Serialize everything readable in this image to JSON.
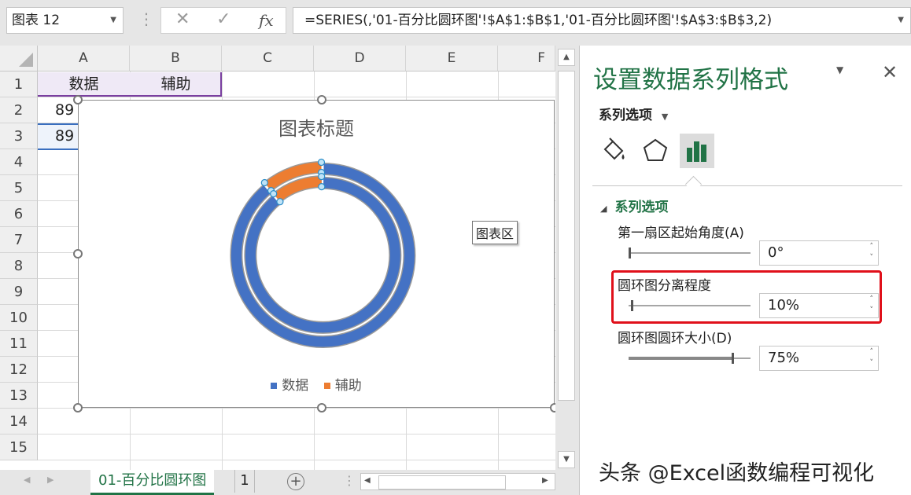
{
  "formula_bar": {
    "name_box": "图表 12",
    "formula": "=SERIES(,'01-百分比圆环图'!$A$1:$B$1,'01-百分比圆环图'!$A$3:$B$3,2)",
    "cancel_glyph": "✕",
    "enter_glyph": "✓",
    "fx_glyph": "fx"
  },
  "columns": [
    "A",
    "B",
    "C",
    "D",
    "E",
    "F"
  ],
  "rows": [
    "1",
    "2",
    "3",
    "4",
    "5",
    "6",
    "7",
    "8",
    "9",
    "10",
    "11",
    "12",
    "13",
    "14",
    "15"
  ],
  "cells": {
    "a1": "数据",
    "b1": "辅助",
    "a2": "89",
    "a3": "89"
  },
  "chart": {
    "title": "图表标题",
    "tooltip": "图表区",
    "legend": [
      {
        "name": "数据",
        "color": "#4472c4"
      },
      {
        "name": "辅助",
        "color": "#ed7d31"
      }
    ]
  },
  "chart_data": {
    "type": "doughnut",
    "title": "图表标题",
    "categories": [
      "数据",
      "辅助"
    ],
    "series": [
      {
        "values": [
          89,
          11
        ]
      },
      {
        "values": [
          89,
          11
        ]
      }
    ],
    "colors": [
      "#4472c4",
      "#ed7d31"
    ],
    "legend_position": "bottom",
    "first_slice_angle": 0,
    "hole_size_pct": 75,
    "explosion_pct": 10
  },
  "sheet_tabs": {
    "active": "01-百分比圆环图",
    "other": "1",
    "add": "+"
  },
  "panel": {
    "title": "设置数据系列格式",
    "series_options_dropdown": "系列选项",
    "section_title": "系列选项",
    "first_slice_label": "第一扇区起始角度(A)",
    "first_slice_value": "0°",
    "explosion_label": "圆环图分离程度",
    "explosion_value": "10%",
    "hole_size_label": "圆环图圆环大小(D)",
    "hole_size_value": "75%",
    "close_glyph": "✕"
  },
  "watermark": "头条 @Excel函数编程可视化",
  "colors": {
    "accent": "#217346",
    "highlight": "#e0101a"
  }
}
